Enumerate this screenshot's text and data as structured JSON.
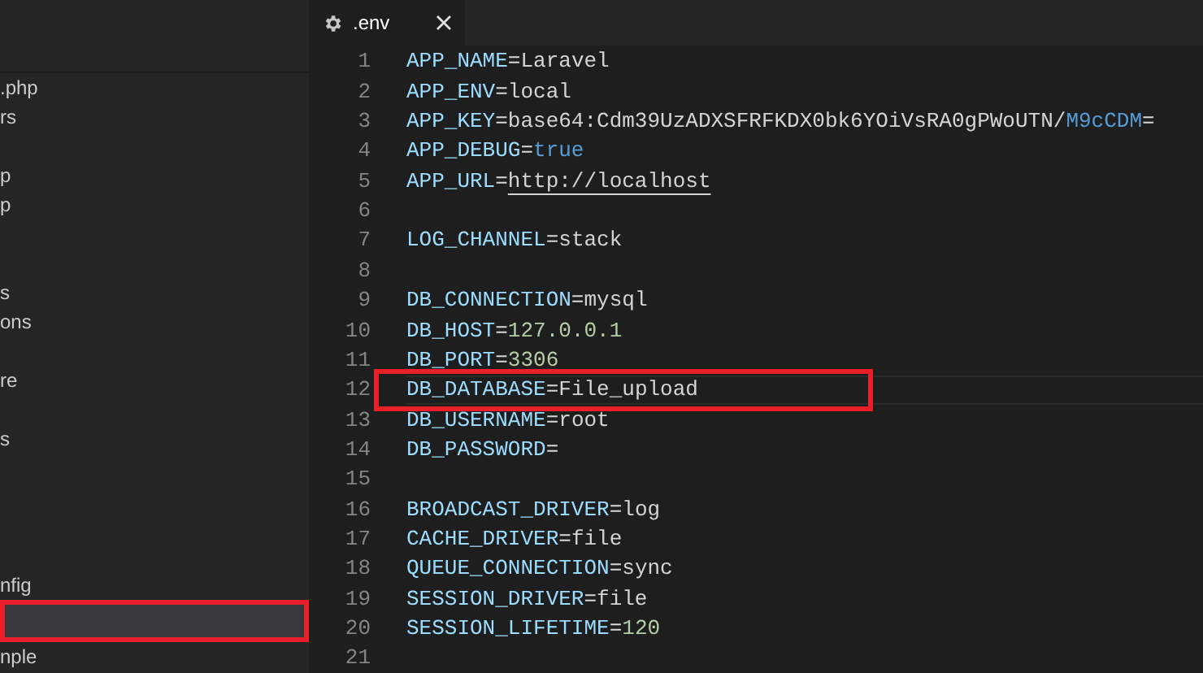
{
  "sidebar": {
    "items": [
      {
        "label": ".php",
        "selected": false,
        "annotated": false
      },
      {
        "label": "rs",
        "selected": false,
        "annotated": false
      },
      {
        "selected": false,
        "annotated": false
      },
      {
        "label": "p",
        "selected": false,
        "annotated": false
      },
      {
        "label": "p",
        "selected": false,
        "annotated": false
      },
      {
        "selected": false,
        "annotated": false
      },
      {
        "selected": false,
        "annotated": false
      },
      {
        "label": "s",
        "selected": false,
        "annotated": false
      },
      {
        "label": "ons",
        "selected": false,
        "annotated": false
      },
      {
        "selected": false,
        "annotated": false
      },
      {
        "label": "re",
        "selected": false,
        "annotated": false
      },
      {
        "selected": false,
        "annotated": false
      },
      {
        "label": "s",
        "selected": false,
        "annotated": false
      },
      {
        "selected": false,
        "annotated": false
      },
      {
        "selected": false,
        "annotated": false
      },
      {
        "selected": false,
        "annotated": false
      },
      {
        "selected": false,
        "annotated": false
      },
      {
        "label": "nfig",
        "selected": false,
        "annotated": false
      },
      {
        "selected": true,
        "annotated": true
      },
      {
        "label": "nple",
        "selected": false,
        "annotated": false
      }
    ]
  },
  "tabs": [
    {
      "label": ".env",
      "selected": true
    }
  ],
  "editor": {
    "lines": [
      {
        "number": "1",
        "current": false,
        "annotated": false,
        "segments": [
          {
            "kind": "key",
            "text": "APP_NAME"
          },
          {
            "kind": "op",
            "text": "="
          },
          {
            "kind": "text",
            "text": "Laravel"
          }
        ]
      },
      {
        "number": "2",
        "current": false,
        "annotated": false,
        "segments": [
          {
            "kind": "key",
            "text": "APP_ENV"
          },
          {
            "kind": "op",
            "text": "="
          },
          {
            "kind": "text",
            "text": "local"
          }
        ]
      },
      {
        "number": "3",
        "current": false,
        "annotated": false,
        "segments": [
          {
            "kind": "key",
            "text": "APP_KEY"
          },
          {
            "kind": "op",
            "text": "="
          },
          {
            "kind": "text",
            "text": "base64:Cdm39UzADXSFRFKDX0bk6YOiVsRA0gPWoUTN/"
          },
          {
            "kind": "keyword",
            "text": "M9cCDM"
          },
          {
            "kind": "op",
            "text": "="
          }
        ]
      },
      {
        "number": "4",
        "current": false,
        "annotated": false,
        "segments": [
          {
            "kind": "key",
            "text": "APP_DEBUG"
          },
          {
            "kind": "op",
            "text": "="
          },
          {
            "kind": "keyword",
            "text": "true"
          }
        ]
      },
      {
        "number": "5",
        "current": false,
        "annotated": false,
        "segments": [
          {
            "kind": "key",
            "text": "APP_URL"
          },
          {
            "kind": "op",
            "text": "="
          },
          {
            "kind": "link",
            "text": "http://localhost"
          }
        ]
      },
      {
        "number": "6",
        "current": false,
        "annotated": false
      },
      {
        "number": "7",
        "current": false,
        "annotated": false,
        "segments": [
          {
            "kind": "key",
            "text": "LOG_CHANNEL"
          },
          {
            "kind": "op",
            "text": "="
          },
          {
            "kind": "text",
            "text": "stack"
          }
        ]
      },
      {
        "number": "8",
        "current": false,
        "annotated": false
      },
      {
        "number": "9",
        "current": false,
        "annotated": false,
        "segments": [
          {
            "kind": "key",
            "text": "DB_CONNECTION"
          },
          {
            "kind": "op",
            "text": "="
          },
          {
            "kind": "text",
            "text": "mysql"
          }
        ]
      },
      {
        "number": "10",
        "current": false,
        "annotated": false,
        "segments": [
          {
            "kind": "key",
            "text": "DB_HOST"
          },
          {
            "kind": "op",
            "text": "="
          },
          {
            "kind": "number",
            "text": "127.0.0.1"
          }
        ]
      },
      {
        "number": "11",
        "current": false,
        "annotated": false,
        "segments": [
          {
            "kind": "key",
            "text": "DB_PORT"
          },
          {
            "kind": "op",
            "text": "="
          },
          {
            "kind": "number",
            "text": "3306"
          }
        ]
      },
      {
        "number": "12",
        "current": true,
        "annotated": true,
        "segments": [
          {
            "kind": "key",
            "text": "DB_DATABASE"
          },
          {
            "kind": "op",
            "text": "="
          },
          {
            "kind": "text",
            "text": "File_upload"
          }
        ]
      },
      {
        "number": "13",
        "current": false,
        "annotated": false,
        "segments": [
          {
            "kind": "key",
            "text": "DB_USERNAME"
          },
          {
            "kind": "op",
            "text": "="
          },
          {
            "kind": "text",
            "text": "root"
          }
        ]
      },
      {
        "number": "14",
        "current": false,
        "annotated": false,
        "segments": [
          {
            "kind": "key",
            "text": "DB_PASSWORD"
          },
          {
            "kind": "op",
            "text": "="
          }
        ]
      },
      {
        "number": "15",
        "current": false,
        "annotated": false
      },
      {
        "number": "16",
        "current": false,
        "annotated": false,
        "segments": [
          {
            "kind": "key",
            "text": "BROADCAST_DRIVER"
          },
          {
            "kind": "op",
            "text": "="
          },
          {
            "kind": "text",
            "text": "log"
          }
        ]
      },
      {
        "number": "17",
        "current": false,
        "annotated": false,
        "segments": [
          {
            "kind": "key",
            "text": "CACHE_DRIVER"
          },
          {
            "kind": "op",
            "text": "="
          },
          {
            "kind": "text",
            "text": "file"
          }
        ]
      },
      {
        "number": "18",
        "current": false,
        "annotated": false,
        "segments": [
          {
            "kind": "key",
            "text": "QUEUE_CONNECTION"
          },
          {
            "kind": "op",
            "text": "="
          },
          {
            "kind": "text",
            "text": "sync"
          }
        ]
      },
      {
        "number": "19",
        "current": false,
        "annotated": false,
        "segments": [
          {
            "kind": "key",
            "text": "SESSION_DRIVER"
          },
          {
            "kind": "op",
            "text": "="
          },
          {
            "kind": "text",
            "text": "file"
          }
        ]
      },
      {
        "number": "20",
        "current": false,
        "annotated": false,
        "segments": [
          {
            "kind": "key",
            "text": "SESSION_LIFETIME"
          },
          {
            "kind": "op",
            "text": "="
          },
          {
            "kind": "number",
            "text": "120"
          }
        ]
      },
      {
        "number": "21",
        "current": false,
        "annotated": false
      }
    ]
  }
}
